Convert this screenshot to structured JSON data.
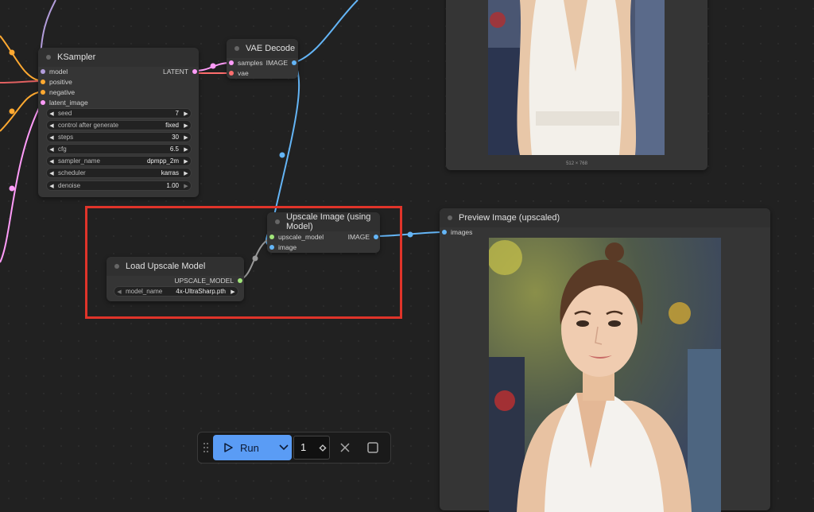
{
  "nodes": {
    "ksampler": {
      "title": "KSampler",
      "inputs": [
        "model",
        "positive",
        "negative",
        "latent_image"
      ],
      "output": "LATENT",
      "widgets": [
        {
          "label": "seed",
          "value": "7"
        },
        {
          "label": "control after generate",
          "value": "fixed"
        },
        {
          "label": "steps",
          "value": "30"
        },
        {
          "label": "cfg",
          "value": "6.5"
        },
        {
          "label": "sampler_name",
          "value": "dpmpp_2m"
        },
        {
          "label": "scheduler",
          "value": "karras"
        },
        {
          "label": "denoise",
          "value": "1.00"
        }
      ]
    },
    "vae_decode": {
      "title": "VAE Decode",
      "inputs": [
        "samples",
        "vae"
      ],
      "output": "IMAGE"
    },
    "upscale_image": {
      "title": "Upscale Image (using Model)",
      "inputs": [
        "upscale_model",
        "image"
      ],
      "output": "IMAGE"
    },
    "load_upscale_model": {
      "title": "Load Upscale Model",
      "output": "UPSCALE_MODEL",
      "widget": {
        "label": "model_name",
        "value": "4x-UltraSharp.pth"
      }
    },
    "preview_upscaled": {
      "title": "Preview Image (upscaled)",
      "input": "images"
    },
    "preview_top": {
      "caption": "512 × 768"
    }
  },
  "toolbar": {
    "run_label": "Run",
    "batch_count": "1"
  },
  "colors": {
    "model": "#b39ddb",
    "conditioning": "#ffa931",
    "latent": "#ff9cf9",
    "image": "#64b5f6",
    "vae": "#ff6e6e",
    "upscale_model": "#a1e57a",
    "highlight": "#e0342a",
    "run_button": "#5a9cf5"
  }
}
